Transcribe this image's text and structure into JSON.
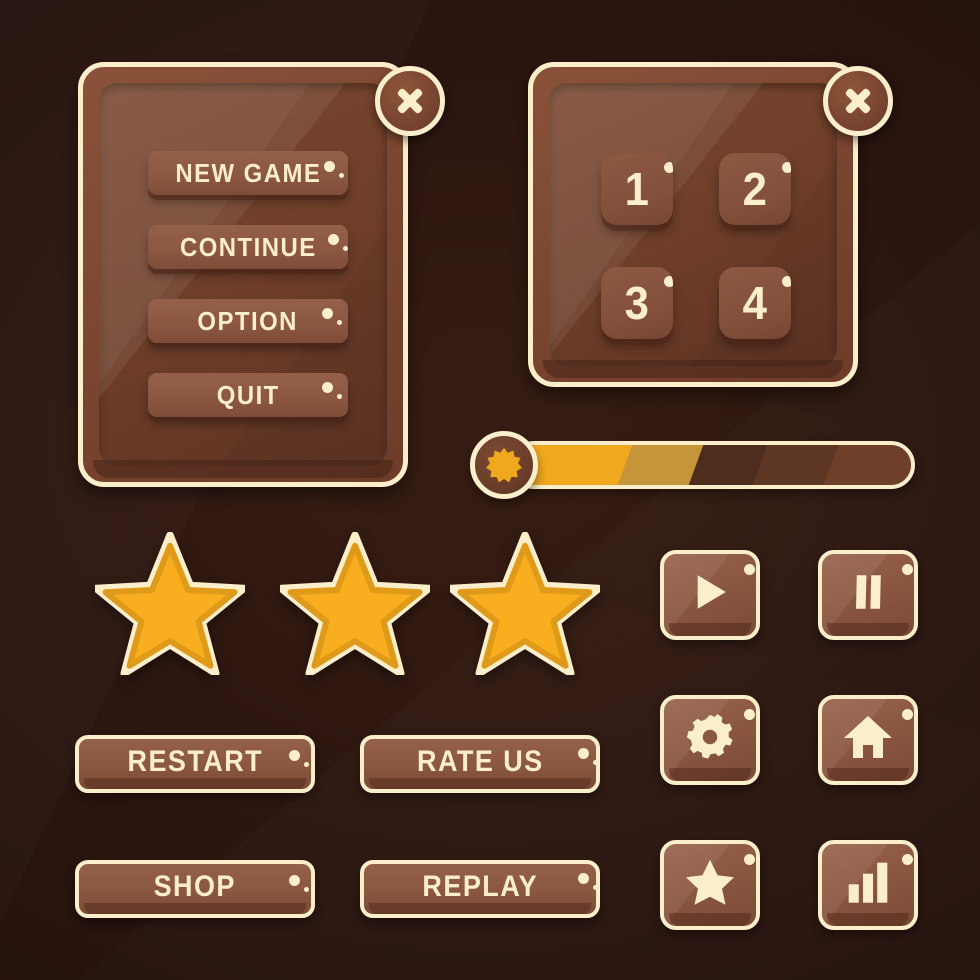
{
  "theme": {
    "background": "#2d1610",
    "panel_fill": "#7c4731",
    "panel_inner": "#6e3e29",
    "border_cream": "#fbeecb",
    "button_fill": "#8b5741",
    "text_cream": "#fbeecb",
    "gold_bright": "#f0a81e",
    "gold_muted": "#c69439",
    "star_fill": "#f9ae20",
    "star_edge": "#e09a1a"
  },
  "menu_panel": {
    "close_label": "close-icon",
    "items": [
      {
        "label": "NEW GAME"
      },
      {
        "label": "CONTINUE"
      },
      {
        "label": "OPTION"
      },
      {
        "label": "QUIT"
      }
    ]
  },
  "level_panel": {
    "close_label": "close-icon",
    "levels": [
      {
        "label": "1"
      },
      {
        "label": "2"
      },
      {
        "label": "3"
      },
      {
        "label": "4"
      }
    ]
  },
  "progress_bar": {
    "badge_icon": "starburst-icon",
    "fill_percent": 46,
    "segments": [
      {
        "name": "bright",
        "color": "#f0a81e",
        "start": 0,
        "end": 28
      },
      {
        "name": "muted",
        "color": "#c69439",
        "start": 28,
        "end": 46
      },
      {
        "name": "shadow-dark",
        "color": "#4f2d1e",
        "start": 46,
        "end": 62
      },
      {
        "name": "shadow-mid",
        "color": "#5d3624",
        "start": 62,
        "end": 80
      },
      {
        "name": "track",
        "color": "#6e4029",
        "start": 80,
        "end": 100
      }
    ]
  },
  "rating": {
    "count": 3,
    "filled": 3,
    "icon": "star-icon"
  },
  "wide_buttons": [
    {
      "label": "RESTART"
    },
    {
      "label": "RATE US"
    },
    {
      "label": "SHOP"
    },
    {
      "label": "REPLAY"
    }
  ],
  "icon_buttons": [
    {
      "icon": "play-icon",
      "name": "play-button"
    },
    {
      "icon": "pause-icon",
      "name": "pause-button"
    },
    {
      "icon": "gear-icon",
      "name": "settings-button"
    },
    {
      "icon": "home-icon",
      "name": "home-button"
    },
    {
      "icon": "star-icon",
      "name": "favorites-button"
    },
    {
      "icon": "bars-icon",
      "name": "stats-button"
    }
  ]
}
